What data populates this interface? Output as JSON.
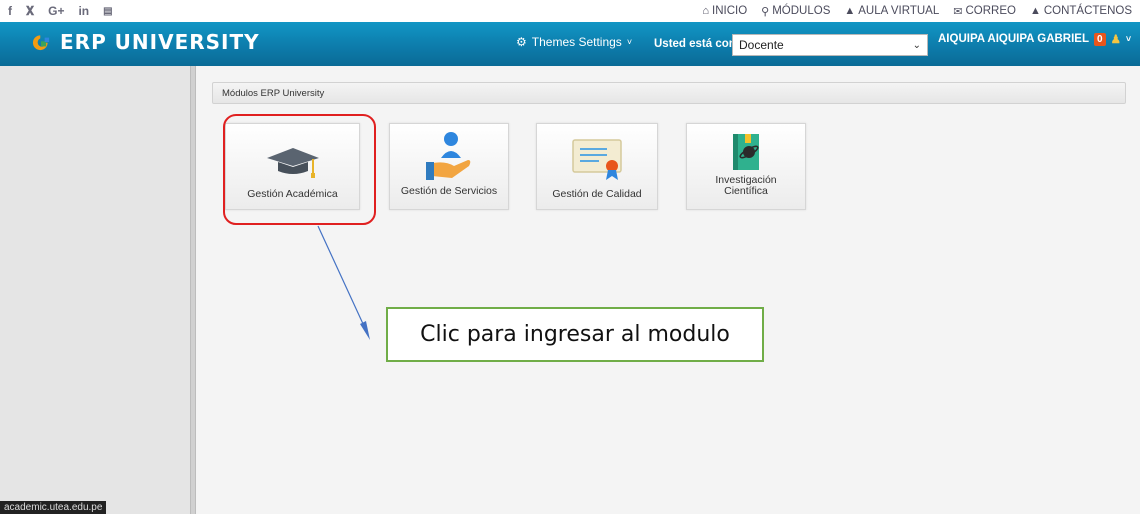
{
  "social_icons": [
    "facebook-icon",
    "twitter-icon",
    "google-plus-icon",
    "linkedin-icon",
    "youtube-icon"
  ],
  "social_glyphs": [
    "f",
    "y",
    "G+",
    "in",
    "You"
  ],
  "top_nav": [
    {
      "label": "INICIO",
      "icon": "home-icon"
    },
    {
      "label": "MÓDULOS",
      "icon": "modules-icon"
    },
    {
      "label": "AULA VIRTUAL",
      "icon": "graduation-cap-icon"
    },
    {
      "label": "CORREO",
      "icon": "mail-icon"
    },
    {
      "label": "CONTÁCTENOS",
      "icon": "bell-icon"
    }
  ],
  "header": {
    "brand": "ERP UNIVERSITY",
    "themes_label": "Themes Settings",
    "usted_label": "Usted está como:",
    "role_selected": "Docente",
    "user_name": "AIQUIPA AIQUIPA GABRIEL",
    "notif_count": "0"
  },
  "breadcrumb": "Módulos ERP University",
  "modules": [
    {
      "label": "Gestión Académica",
      "icon": "graduation-cap-icon"
    },
    {
      "label": "Gestión de Servicios",
      "icon": "service-hand-icon"
    },
    {
      "label": "Gestión de Calidad",
      "icon": "certificate-icon"
    },
    {
      "label": "Investigación Científica",
      "label_line1": "Investigación",
      "label_line2": "Científica",
      "icon": "science-book-icon"
    }
  ],
  "callout_text": "Clic para ingresar al modulo",
  "status_url": "academic.utea.edu.pe",
  "colors": {
    "header": "#0d7aa9",
    "highlight": "#e02020",
    "callout_border": "#70ad47",
    "arrow": "#4472c4"
  }
}
